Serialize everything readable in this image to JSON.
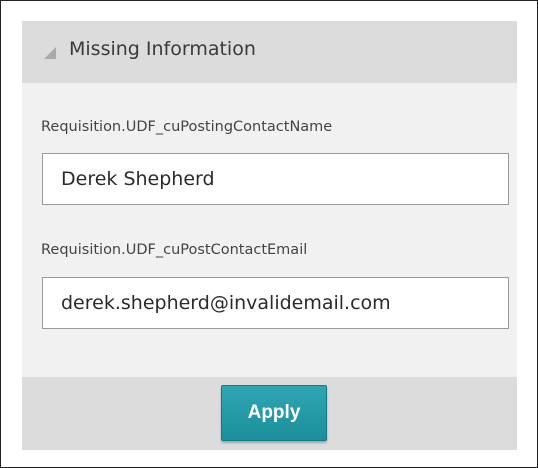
{
  "panel": {
    "title": "Missing Information",
    "collapse_icon": "triangle-collapse-icon"
  },
  "fields": [
    {
      "label": "Requisition.UDF_cuPostingContactName",
      "value": "Derek Shepherd"
    },
    {
      "label": "Requisition.UDF_cuPostContactEmail",
      "value": "derek.shepherd@invalidemail.com"
    }
  ],
  "footer": {
    "apply_label": "Apply"
  },
  "colors": {
    "accent": "#1f96a3",
    "header_bg": "#dcdcdc",
    "panel_bg": "#f1f1f1"
  }
}
